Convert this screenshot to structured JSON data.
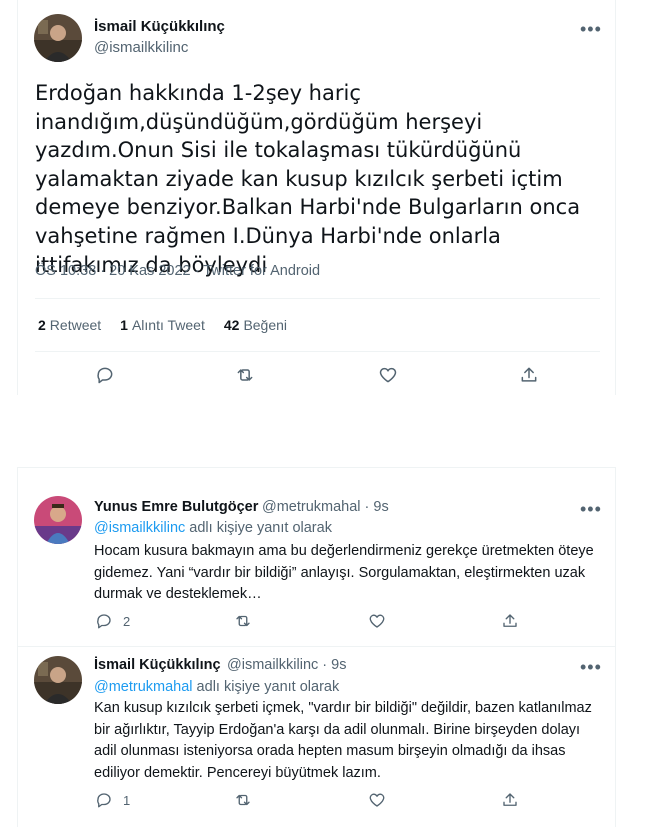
{
  "main_tweet": {
    "author_name": "İsmail Küçükkılınç",
    "author_handle": "@ismailkkilinc",
    "text": "Erdoğan hakkında 1-2şey hariç inandığım,düşündüğüm,gördüğüm herşeyi yazdım.Onun Sisi ile tokalaşması tükürdüğünü yalamaktan ziyade kan kusup kızılcık şerbeti içtim demeye benziyor.Balkan Harbi'nde Bulgarların onca vahşetine rağmen I.Dünya Harbi'nde onlarla ittifakımız da böyleydi",
    "meta": "ÖS 10:38 · 20 Kas 2022 · Twitter for Android",
    "retweets_count": "2",
    "retweets_label": "Retweet",
    "quotes_count": "1",
    "quotes_label": "Alıntı Tweet",
    "likes_count": "42",
    "likes_label": "Beğeni"
  },
  "replies": [
    {
      "author_name": "Yunus Emre Bulutgöçer",
      "author_handle": "@metrukmahal · 9s",
      "reply_to_handle": "@ismailkkilinc",
      "reply_to_suffix": " adlı kişiye yanıt olarak",
      "text": "Hocam kusura bakmayın ama bu değerlendirmeniz gerekçe üretmekten öteye gidemez. Yani “vardır bir bildiği” anlayışı. Sorgulamaktan, eleştirmekten uzak durmak ve desteklemek…",
      "reply_count": "2"
    },
    {
      "author_name": "İsmail Küçükkılınç",
      "author_handle": "@ismailkkilinc · 9s",
      "reply_to_handle": "@metrukmahal",
      "reply_to_suffix": " adlı kişiye yanıt olarak",
      "text": "Kan kusup kızılcık şerbeti içmek, \"vardır bir bildiği\" değildir, bazen katlanılmaz bir ağırlıktır, Tayyip Erdoğan'a karşı da adil olunmalı. Birine birşeyden dolayı adil olunması isteniyorsa orada hepten masum birşeyin olmadığı da ihsas ediliyor demektir. Pencereyi büyütmek lazım.",
      "reply_count": "1"
    }
  ],
  "icons": {
    "more": "more-horizontal-icon",
    "reply": "reply-bubble-icon",
    "retweet": "retweet-icon",
    "like": "heart-icon",
    "share": "share-upload-icon"
  },
  "colors": {
    "link": "#1d9bf0",
    "secondary_text": "#536471",
    "border": "#eff3f4"
  }
}
